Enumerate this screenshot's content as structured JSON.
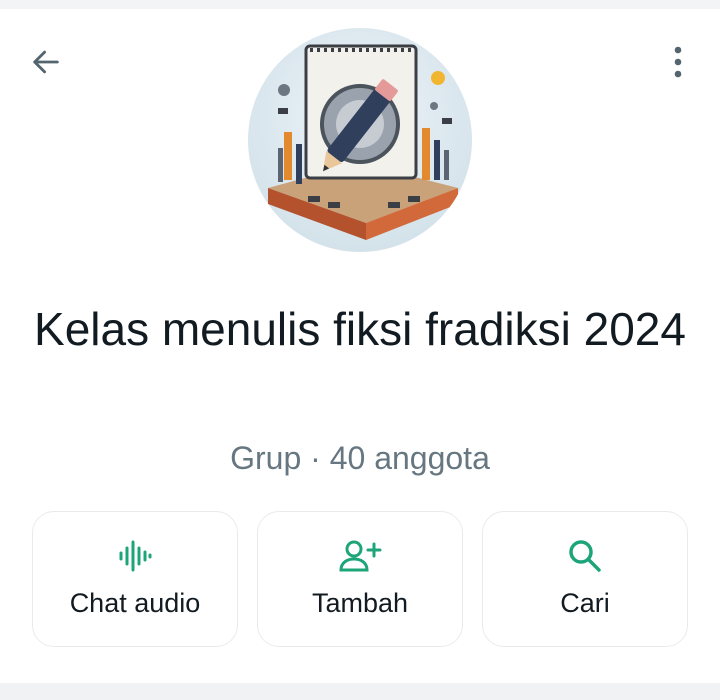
{
  "header": {
    "back_icon": "arrow-left-icon",
    "menu_icon": "more-vertical-icon"
  },
  "group": {
    "name": "Kelas menulis fiksi fradiksi 2024",
    "subtitle": "Grup · 40 anggota",
    "avatar": "group-avatar-image"
  },
  "actions": [
    {
      "label": "Chat audio",
      "icon": "audio-wave-icon"
    },
    {
      "label": "Tambah",
      "icon": "add-person-icon"
    },
    {
      "label": "Cari",
      "icon": "search-icon"
    }
  ],
  "colors": {
    "accent": "#1da57a",
    "text_primary": "#111b21",
    "text_secondary": "#667781",
    "border": "#e8ebed",
    "background": "#ffffff"
  }
}
